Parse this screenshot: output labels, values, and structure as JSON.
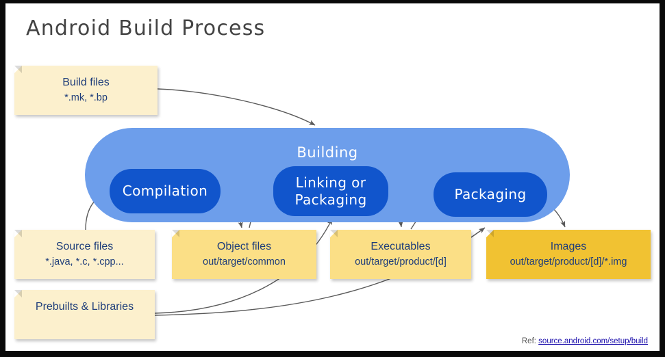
{
  "title": "Android Build Process",
  "container": {
    "label": "Building",
    "color": "#6d9eeb"
  },
  "stages": [
    {
      "name": "compilation",
      "label": "Compilation",
      "color": "#1155cc"
    },
    {
      "name": "linking-or-packaging",
      "label": "Linking or\nPackaging",
      "line1": "Linking or",
      "line2": "Packaging",
      "color": "#1155cc"
    },
    {
      "name": "packaging",
      "label": "Packaging",
      "color": "#1155cc"
    }
  ],
  "notes": {
    "build_files": {
      "line1": "Build files",
      "line2": "*.mk, *.bp",
      "color": "#fcf0cd"
    },
    "source_files": {
      "line1": "Source files",
      "line2": "*.java, *.c, *.cpp...",
      "color": "#fcf0cd"
    },
    "prebuilts": {
      "line1": "Prebuilts & Libraries",
      "line2": "",
      "color": "#fcf0cd"
    },
    "object_files": {
      "line1": "Object files",
      "line2": "out/target/common",
      "color": "#fbdf86"
    },
    "executables": {
      "line1": "Executables",
      "line2": "out/target/product/[d]",
      "color": "#fbdf86"
    },
    "images": {
      "line1": "Images",
      "line2": "out/target/product/[d]/*.img",
      "color": "#f1c232"
    }
  },
  "footer": {
    "prefix": "Ref: ",
    "link": "source.android.com/setup/build",
    "link_color": "#1a0dab"
  },
  "text_colors": {
    "title": "#434343",
    "note_text": "#1f3d7a",
    "stage_text": "#ffffff",
    "container_label": "#ffffff"
  }
}
